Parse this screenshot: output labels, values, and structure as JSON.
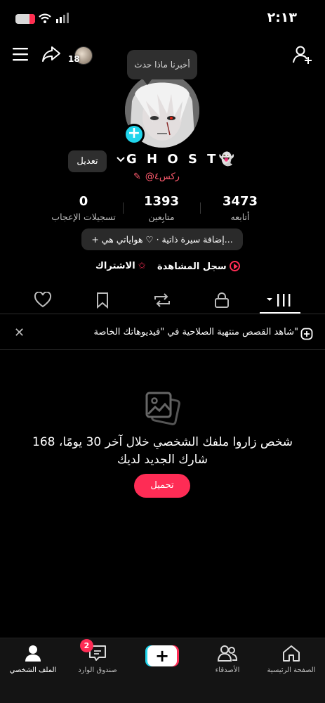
{
  "status": {
    "time": "٢:١٣",
    "battery_level_percent": 25
  },
  "header": {
    "notification_count": "18"
  },
  "profile": {
    "avatar_tooltip": "أخبرنا ماذا حدث",
    "edit_label": "تعديل",
    "display_name": "G H O S T👻",
    "handle": "@ركس٤",
    "stats": [
      {
        "value": "3473",
        "label": "أتابعه"
      },
      {
        "value": "1393",
        "label": "متابِعين"
      },
      {
        "value": "0",
        "label": "تسجيلات الإعجاب"
      }
    ],
    "bio_button": "+ إضافة سيرة ذاتية · ♡ هواياتي هي...",
    "watch_history": "سجل المشاهدة",
    "subscription": "الاشتراك"
  },
  "tabs": {
    "icons": [
      "videos-grid-icon",
      "lock-icon",
      "repost-icon",
      "bookmark-icon",
      "heart-icon"
    ],
    "active": "videos-grid-icon"
  },
  "banner": {
    "text": "شاهد القصص منتهية الصلاحية في \"فيديوهاتك الخاصة\""
  },
  "empty_state": {
    "message": "168 شخص زاروا ملفك الشخصي خلال آخر 30 يومًا، شارك الجديد لديك",
    "upload_label": "تحميل"
  },
  "bottom_nav": {
    "items": [
      {
        "label": "الصفحة الرئيسية",
        "icon": "home-icon"
      },
      {
        "label": "الأصدقاء",
        "icon": "friends-icon"
      },
      {
        "label": "",
        "icon": "create-icon"
      },
      {
        "label": "صندوق الوارد",
        "icon": "inbox-icon",
        "badge": "2"
      },
      {
        "label": "الملف الشخصي",
        "icon": "profile-icon"
      }
    ]
  },
  "colors": {
    "accent": "#fe2c55",
    "cyan": "#20d5ec",
    "background": "#000000",
    "handle": "#ff5b6e"
  }
}
